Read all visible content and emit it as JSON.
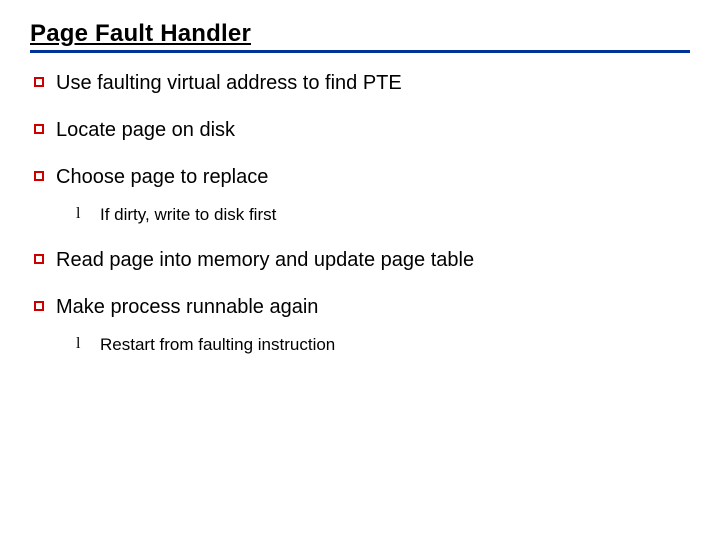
{
  "title": "Page Fault Handler",
  "items": [
    {
      "text": "Use faulting virtual address to find PTE"
    },
    {
      "text": "Locate page on disk"
    },
    {
      "text": "Choose page to replace",
      "sub": [
        {
          "text": "If dirty, write to disk first"
        }
      ]
    },
    {
      "text": "Read page into memory and update page table"
    },
    {
      "text": "Make process runnable again",
      "sub": [
        {
          "text": "Restart from faulting instruction"
        }
      ]
    }
  ],
  "sub_bullet_glyph": "l"
}
